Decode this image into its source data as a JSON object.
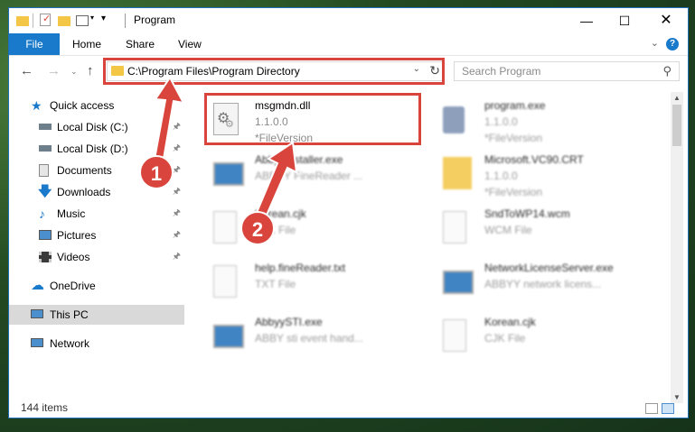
{
  "window": {
    "title": "Program"
  },
  "ribbon": {
    "file": "File",
    "tabs": [
      "Home",
      "Share",
      "View"
    ],
    "help": "?"
  },
  "address": {
    "path": "C:\\Program Files\\Program Directory"
  },
  "search": {
    "placeholder": "Search Program"
  },
  "sidebar": {
    "items": [
      {
        "label": "Quick access",
        "icon": "star-icon",
        "pinned": false
      },
      {
        "label": "Local Disk (C:)",
        "icon": "drive-icon",
        "pinned": true
      },
      {
        "label": "Local Disk (D:)",
        "icon": "drive-icon",
        "pinned": true
      },
      {
        "label": "Documents",
        "icon": "documents-icon",
        "pinned": true
      },
      {
        "label": "Downloads",
        "icon": "download-icon",
        "pinned": true
      },
      {
        "label": "Music",
        "icon": "music-icon",
        "pinned": true
      },
      {
        "label": "Pictures",
        "icon": "pictures-icon",
        "pinned": true
      },
      {
        "label": "Videos",
        "icon": "videos-icon",
        "pinned": true
      },
      {
        "label": "OneDrive",
        "icon": "cloud-icon",
        "pinned": false
      },
      {
        "label": "This PC",
        "icon": "computer-icon",
        "pinned": false
      },
      {
        "label": "Network",
        "icon": "network-icon",
        "pinned": false
      }
    ]
  },
  "files": [
    {
      "name": "msgmdn.dll",
      "line2": "1.1.0.0",
      "line3": "*FileVersion",
      "icon": "dll-gear-icon"
    },
    {
      "name": "program.exe",
      "line2": "1.1.0.0",
      "line3": "*FileVersion",
      "icon": "exe-icon"
    },
    {
      "name": "AbbyyInstaller.exe",
      "line2": "ABBYY FineReader ...",
      "line3": "",
      "icon": "exe-window-icon"
    },
    {
      "name": "Microsoft.VC90.CRT",
      "line2": "1.1.0.0",
      "line3": "*FileVersion",
      "icon": "folder-icon"
    },
    {
      "name": "Korean.cjk",
      "line2": "CJK File",
      "line3": "",
      "icon": "blank-file-icon"
    },
    {
      "name": "SndToWP14.wcm",
      "line2": "WCM File",
      "line3": "",
      "icon": "blank-file-icon"
    },
    {
      "name": "help.fineReader.txt",
      "line2": "TXT File",
      "line3": "",
      "icon": "blank-file-icon"
    },
    {
      "name": "NetworkLicenseServer.exe",
      "line2": "ABBYY network licens...",
      "line3": "",
      "icon": "exe-window-icon"
    },
    {
      "name": "AbbyySTI.exe",
      "line2": "ABBY sti event hand...",
      "line3": "",
      "icon": "exe-window-icon"
    },
    {
      "name": "Korean.cjk",
      "line2": "CJK File",
      "line3": "",
      "icon": "blank-file-icon"
    }
  ],
  "status": {
    "count": "144 items"
  },
  "callouts": [
    "1",
    "2"
  ],
  "colors": {
    "accent": "#1979ca",
    "highlight": "#d9453c"
  }
}
